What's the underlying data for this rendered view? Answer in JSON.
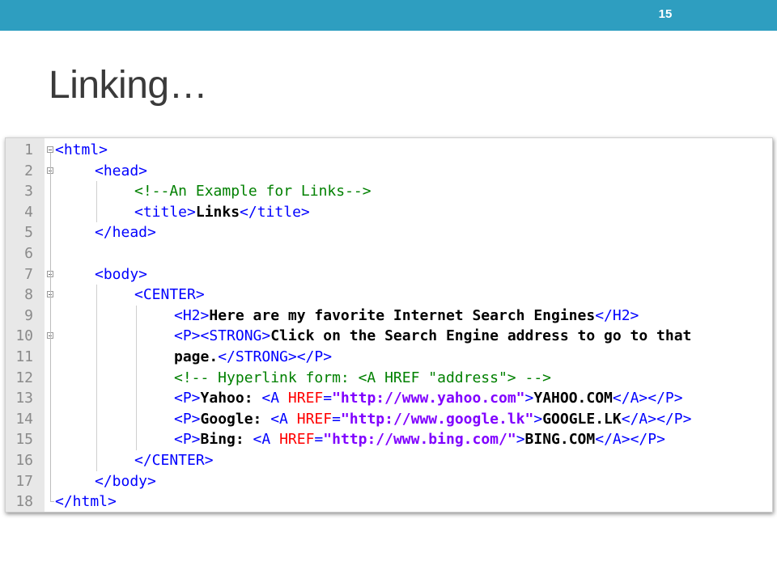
{
  "slide": {
    "number": "15",
    "title": "Linking…"
  },
  "colors": {
    "header_bar": "#2e9ec0",
    "tag": "#0000ff",
    "comment": "#008000",
    "attribute": "#ff0000",
    "attribute_value": "#8000ff"
  },
  "code": {
    "lines": [
      {
        "no": "1",
        "fold": true,
        "indent": 0,
        "tokens": [
          {
            "t": "<html>",
            "c": "tag"
          }
        ]
      },
      {
        "no": "2",
        "fold": true,
        "indent": 1,
        "tokens": [
          {
            "t": "<head>",
            "c": "tag"
          }
        ]
      },
      {
        "no": "3",
        "fold": false,
        "indent": 2,
        "tokens": [
          {
            "t": "<!--An Example for Links-->",
            "c": "cmt"
          }
        ]
      },
      {
        "no": "4",
        "fold": false,
        "indent": 2,
        "tokens": [
          {
            "t": "<title>",
            "c": "tag"
          },
          {
            "t": "Links",
            "c": "bold"
          },
          {
            "t": "</title>",
            "c": "tag"
          }
        ]
      },
      {
        "no": "5",
        "fold": false,
        "indent": 1,
        "tokens": [
          {
            "t": "</head>",
            "c": "tag"
          }
        ]
      },
      {
        "no": "6",
        "fold": false,
        "indent": 0,
        "tokens": []
      },
      {
        "no": "7",
        "fold": true,
        "indent": 1,
        "tokens": [
          {
            "t": "<body>",
            "c": "tag"
          }
        ]
      },
      {
        "no": "8",
        "fold": true,
        "indent": 2,
        "tokens": [
          {
            "t": "<CENTER>",
            "c": "tag"
          }
        ]
      },
      {
        "no": "9",
        "fold": false,
        "indent": 3,
        "tokens": [
          {
            "t": "<H2>",
            "c": "tag"
          },
          {
            "t": "Here are my favorite Internet Search Engines",
            "c": "bold"
          },
          {
            "t": "</H2>",
            "c": "tag"
          }
        ]
      },
      {
        "no": "10",
        "fold": true,
        "indent": 3,
        "tokens": [
          {
            "t": "<P><STRONG>",
            "c": "tag"
          },
          {
            "t": "Click on the Search Engine address to go to that",
            "c": "bold"
          }
        ]
      },
      {
        "no": "11",
        "fold": false,
        "indent": 3,
        "tokens": [
          {
            "t": "page.",
            "c": "bold"
          },
          {
            "t": "</STRONG></P>",
            "c": "tag"
          }
        ]
      },
      {
        "no": "12",
        "fold": false,
        "indent": 3,
        "tokens": [
          {
            "t": "<!-- Hyperlink form: <A HREF \"address\"> -->",
            "c": "cmt"
          }
        ]
      },
      {
        "no": "13",
        "fold": false,
        "indent": 3,
        "tokens": [
          {
            "t": "<P>",
            "c": "tag"
          },
          {
            "t": "Yahoo: ",
            "c": "bold"
          },
          {
            "t": "<A ",
            "c": "tag"
          },
          {
            "t": "HREF",
            "c": "attr"
          },
          {
            "t": "=",
            "c": "tag"
          },
          {
            "t": "\"http://www.yahoo.com\"",
            "c": "str"
          },
          {
            "t": ">",
            "c": "tag"
          },
          {
            "t": "YAHOO.COM",
            "c": "bold"
          },
          {
            "t": "</A></P>",
            "c": "tag"
          }
        ]
      },
      {
        "no": "14",
        "fold": false,
        "indent": 3,
        "tokens": [
          {
            "t": "<P>",
            "c": "tag"
          },
          {
            "t": "Google: ",
            "c": "bold"
          },
          {
            "t": "<A ",
            "c": "tag"
          },
          {
            "t": "HREF",
            "c": "attr"
          },
          {
            "t": "=",
            "c": "tag"
          },
          {
            "t": "\"http://www.google.lk\"",
            "c": "str"
          },
          {
            "t": ">",
            "c": "tag"
          },
          {
            "t": "GOOGLE.LK",
            "c": "bold"
          },
          {
            "t": "</A></P>",
            "c": "tag"
          }
        ]
      },
      {
        "no": "15",
        "fold": false,
        "indent": 3,
        "tokens": [
          {
            "t": "<P>",
            "c": "tag"
          },
          {
            "t": "Bing: ",
            "c": "bold"
          },
          {
            "t": "<A ",
            "c": "tag"
          },
          {
            "t": "HREF",
            "c": "attr"
          },
          {
            "t": "=",
            "c": "tag"
          },
          {
            "t": "\"http://www.bing.com/\"",
            "c": "str"
          },
          {
            "t": ">",
            "c": "tag"
          },
          {
            "t": "BING.COM",
            "c": "bold"
          },
          {
            "t": "</A></P>",
            "c": "tag"
          }
        ]
      },
      {
        "no": "16",
        "fold": false,
        "indent": 2,
        "tokens": [
          {
            "t": "</CENTER>",
            "c": "tag"
          }
        ]
      },
      {
        "no": "17",
        "fold": false,
        "indent": 1,
        "tokens": [
          {
            "t": "</body>",
            "c": "tag"
          }
        ]
      },
      {
        "no": "18",
        "fold": false,
        "indent": 0,
        "tokens": [
          {
            "t": "</html>",
            "c": "tag"
          }
        ]
      }
    ]
  }
}
